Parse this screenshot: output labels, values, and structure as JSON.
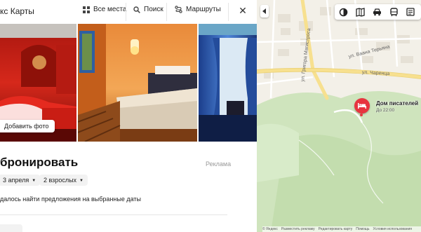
{
  "header": {
    "brand": "кс Карты",
    "nav": [
      {
        "label": "Все места",
        "icon": "grid-icon"
      },
      {
        "label": "Поиск",
        "icon": "search-icon"
      },
      {
        "label": "Маршруты",
        "icon": "routes-icon"
      }
    ],
    "close_label": "✕"
  },
  "gallery": {
    "add_photo_label": "Добавить фото"
  },
  "booking": {
    "title": "бронировать",
    "ad_label": "Реклама",
    "date_label": "3 апреля",
    "guests_label": "2 взрослых",
    "caret": "▼",
    "message": "далось найти предложения на выбранные даты"
  },
  "map": {
    "streets": [
      {
        "label": "ул. Григора Магистроса"
      },
      {
        "label": "ул. Ваана Терьяна"
      },
      {
        "label": "ул. Чаренца"
      }
    ],
    "poi": {
      "name": "Дом писателей",
      "hours": "До 22:00",
      "icon": "bed-icon"
    },
    "tools": [
      "layers-icon",
      "panorama-icon",
      "traffic-icon",
      "transport-icon",
      "more-icon"
    ],
    "attribution": [
      "© Яндекс",
      "Разместить рекламу",
      "Редактировать карту",
      "Помощь",
      "Условия использования"
    ],
    "colors": {
      "park": "#cfe4bd",
      "land": "#f3f0e8",
      "road_major": "#f7e08f",
      "pin": "#e7343f"
    }
  }
}
